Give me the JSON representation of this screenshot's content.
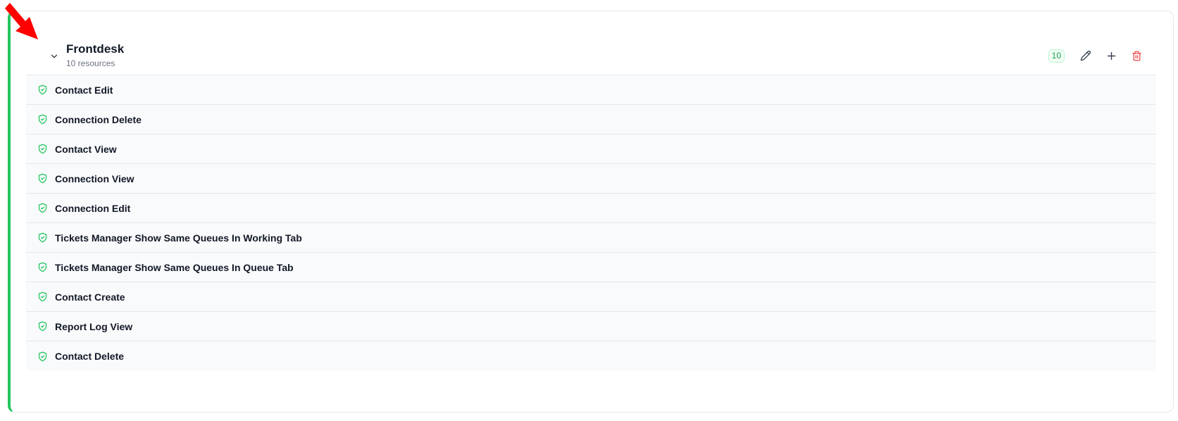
{
  "group": {
    "title": "Frontdesk",
    "subtitle": "10 resources",
    "count_badge": "10"
  },
  "colors": {
    "accent": "#22c55e",
    "shield": "#22c55e",
    "delete": "#ef4444",
    "arrow": "#ff0000"
  },
  "icons": {
    "collapse": "chevron-down-icon",
    "edit": "pencil-icon",
    "add": "plus-icon",
    "delete": "trash-icon",
    "item": "shield-check-icon"
  },
  "resources": [
    {
      "label": "Contact Edit"
    },
    {
      "label": "Connection Delete"
    },
    {
      "label": "Contact View"
    },
    {
      "label": "Connection View"
    },
    {
      "label": "Connection Edit"
    },
    {
      "label": "Tickets Manager Show Same Queues In Working Tab"
    },
    {
      "label": "Tickets Manager Show Same Queues In Queue Tab"
    },
    {
      "label": "Contact Create"
    },
    {
      "label": "Report Log View"
    },
    {
      "label": "Contact Delete"
    }
  ]
}
